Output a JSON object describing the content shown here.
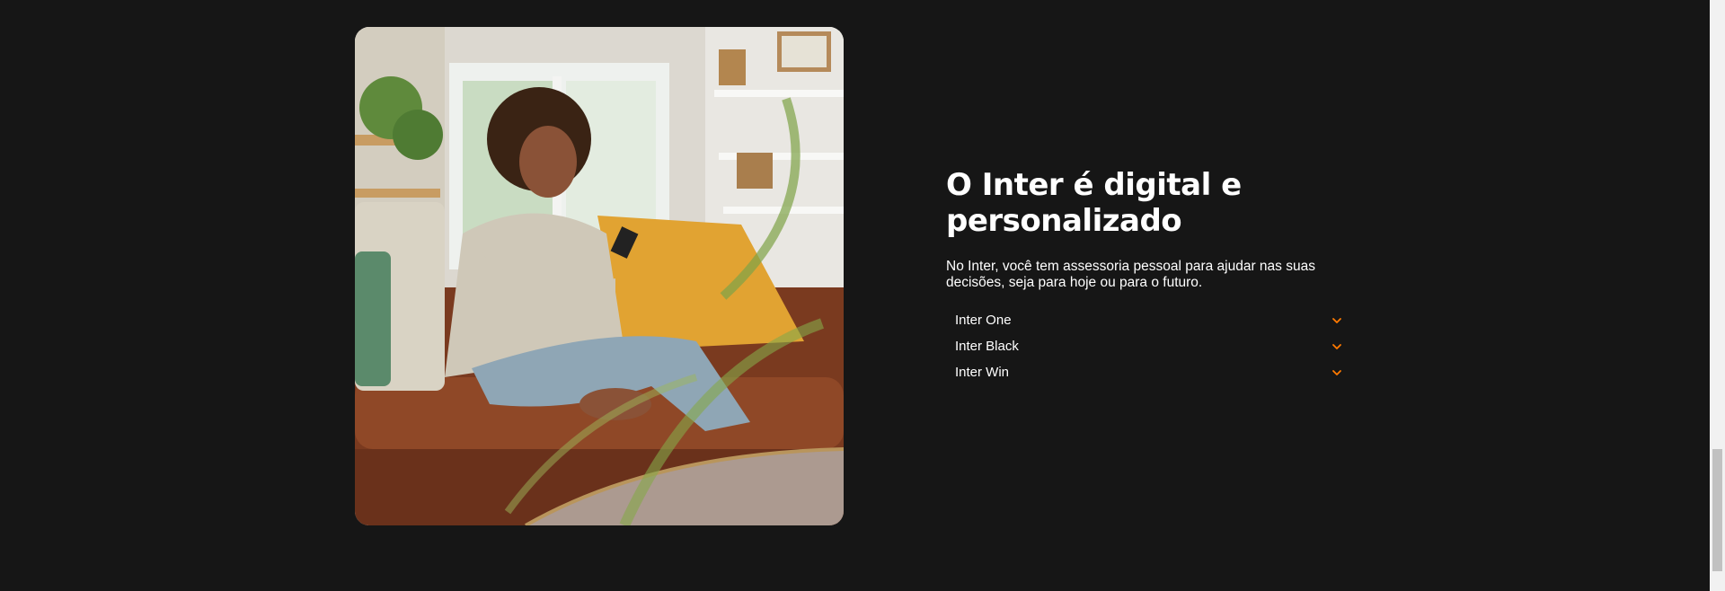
{
  "section": {
    "title": "O Inter é digital e personalizado",
    "description": "No Inter, você tem assessoria pessoal para ajudar nas suas decisões, seja para hoje ou para o futuro.",
    "accordion": [
      {
        "label": "Inter One",
        "icon": "chevron-down-icon"
      },
      {
        "label": "Inter Black",
        "icon": "chevron-down-icon"
      },
      {
        "label": "Inter Win",
        "icon": "chevron-down-icon"
      }
    ]
  },
  "colors": {
    "background": "#161616",
    "text": "#ffffff",
    "accent": "#ff7a00"
  },
  "image": {
    "alt": "woman-on-sofa-using-phone"
  }
}
